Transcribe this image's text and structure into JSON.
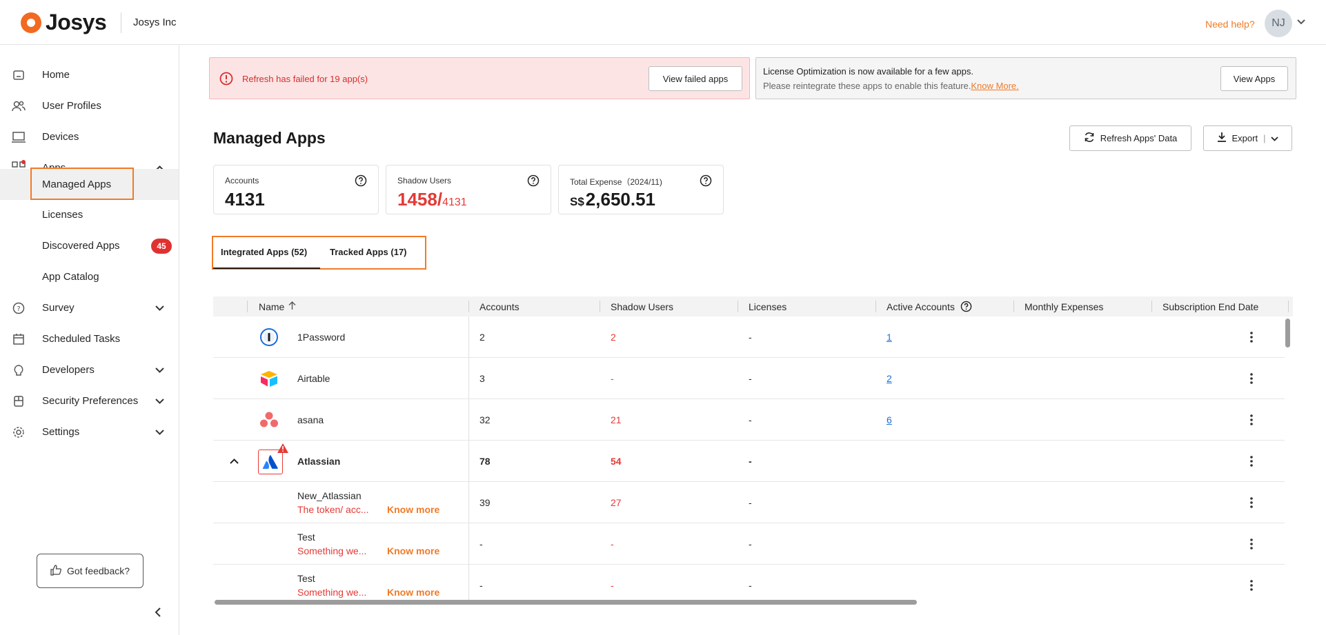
{
  "header": {
    "logo_text": "Josys",
    "org_name": "Josys Inc",
    "need_help": "Need help?",
    "avatar_initials": "NJ"
  },
  "sidebar": {
    "items": [
      {
        "label": "Home",
        "icon": "home-icon"
      },
      {
        "label": "User Profiles",
        "icon": "users-icon"
      },
      {
        "label": "Devices",
        "icon": "laptop-icon"
      },
      {
        "label": "Apps",
        "icon": "apps-grid-icon",
        "expanded": true
      },
      {
        "label": "Managed Apps",
        "active": true
      },
      {
        "label": "Licenses"
      },
      {
        "label": "Discovered Apps",
        "badge": "45"
      },
      {
        "label": "App Catalog"
      },
      {
        "label": "Survey",
        "icon": "survey-icon"
      },
      {
        "label": "Scheduled Tasks",
        "icon": "calendar-icon"
      },
      {
        "label": "Developers",
        "icon": "developers-icon"
      },
      {
        "label": "Security Preferences",
        "icon": "shield-icon"
      },
      {
        "label": "Settings",
        "icon": "gear-icon"
      }
    ],
    "feedback_label": "Got feedback?"
  },
  "alerts": {
    "fail_text": "Refresh has failed for 19 app(s)",
    "fail_button": "View failed apps",
    "info_line1": "License Optimization is now available for a few apps.",
    "info_line2": "Please reintegrate these apps to enable this feature.",
    "info_link": "Know More.",
    "info_button": "View Apps"
  },
  "page": {
    "title": "Managed Apps",
    "refresh_button": "Refresh Apps' Data",
    "export_button": "Export"
  },
  "cards": {
    "accounts_label": "Accounts",
    "accounts_value": "4131",
    "shadow_label": "Shadow Users",
    "shadow_value": "1458/",
    "shadow_total": "4131",
    "expense_label": "Total Expense（2024/11)",
    "expense_currency": "S$",
    "expense_value": "2,650.51"
  },
  "tabs": {
    "integrated": "Integrated Apps (52)",
    "tracked": "Tracked Apps (17)"
  },
  "table": {
    "columns": [
      "Name",
      "Accounts",
      "Shadow Users",
      "Licenses",
      "Active Accounts",
      "Monthly Expenses",
      "Subscription End Date"
    ],
    "rows": [
      {
        "name": "1Password",
        "accounts": "2",
        "shadow": "2",
        "licenses": "-",
        "active": "1"
      },
      {
        "name": "Airtable",
        "accounts": "3",
        "shadow": "-",
        "licenses": "-",
        "active": "2"
      },
      {
        "name": "asana",
        "accounts": "32",
        "shadow": "21",
        "licenses": "-",
        "active": "6"
      },
      {
        "name": "Atlassian",
        "accounts": "78",
        "shadow": "54",
        "licenses": "-",
        "active": ""
      },
      {
        "name": "New_Atlassian",
        "error": "The token/ acc...",
        "know_more": "Know more",
        "accounts": "39",
        "shadow": "27",
        "licenses": "-"
      },
      {
        "name": "Test",
        "error": "Something we...",
        "know_more": "Know more",
        "accounts": "-",
        "shadow": "-",
        "licenses": "-"
      },
      {
        "name": "Test",
        "error": "Something we...",
        "know_more": "Know more",
        "accounts": "-",
        "shadow": "-",
        "licenses": "-"
      }
    ]
  },
  "colors": {
    "accent": "#f07a27",
    "error": "#e53935",
    "link": "#1e6fd9"
  }
}
